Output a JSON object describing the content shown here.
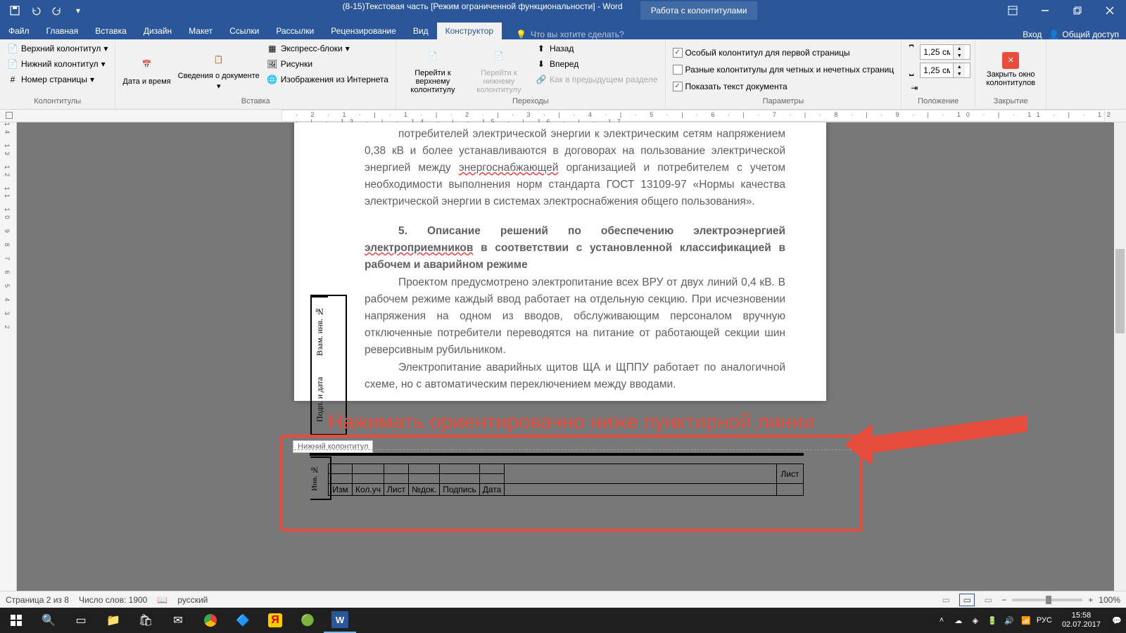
{
  "titlebar": {
    "doc_title": "(8-15)Текстовая часть [Режим ограниченной функциональности] - Word",
    "context_title": "Работа с колонтитулами"
  },
  "tabs": {
    "file": "Файл",
    "items": [
      "Главная",
      "Вставка",
      "Дизайн",
      "Макет",
      "Ссылки",
      "Рассылки",
      "Рецензирование",
      "Вид"
    ],
    "active": "Конструктор",
    "tellme": "Что вы хотите сделать?",
    "signin": "Вход",
    "share": "Общий доступ"
  },
  "ribbon": {
    "g1": {
      "top_header": "Верхний колонтитул",
      "bottom_header": "Нижний колонтитул",
      "page_num": "Номер страницы",
      "label": "Колонтитулы"
    },
    "g2": {
      "datetime": "Дата и время",
      "docinfo": "Сведения о документе",
      "quickparts": "Экспресс-блоки",
      "pictures": "Рисунки",
      "online_pics": "Изображения из Интернета",
      "label": "Вставка"
    },
    "g3": {
      "goto_header": "Перейти к верхнему колонтитулу",
      "goto_footer": "Перейти к нижнему колонтитулу",
      "prev": "Назад",
      "next": "Вперед",
      "link_prev": "Как в предыдущем разделе",
      "label": "Переходы"
    },
    "g4": {
      "diff_first": "Особый колонтитул для первой страницы",
      "diff_odd": "Разные колонтитулы для четных и нечетных страниц",
      "show_doc": "Показать текст документа",
      "label": "Параметры"
    },
    "g5": {
      "top_val": "1,25 см",
      "bottom_val": "1,25 см",
      "label": "Положение"
    },
    "g6": {
      "close": "Закрыть окно колонтитулов",
      "label": "Закрытие"
    }
  },
  "document": {
    "para1_a": "потребителей электрической энергии к электрическим сетям напряжением 0,38 кВ и более устанавливаются в договорах на пользование электрической энергией между ",
    "para1_u": "энергоснабжающей",
    "para1_b": " организацией и потребителем с учетом необходимости выполнения норм стандарта ГОСТ 13109-97 «Нормы качества электрической энергии в системах электроснабжения общего пользования».",
    "heading_a": "5. Описание решений по обеспечению электроэнергией ",
    "heading_u": "электроприемников",
    "heading_b": " в соответствии с установленной классификацией в рабочем и аварийном режиме",
    "para2": "Проектом предусмотрено электропитание всех ВРУ от двух линий 0,4 кВ. В рабочем режиме каждый ввод работает на отдельную секцию. При исчезновении напряжения на одном из вводов, обслуживающим персоналом вручную отключенные потребители переводятся на питание от работающей секции шин реверсивным рубильником.",
    "para3": "Электропитание аварийных щитов ЩА и ЩППУ работает по аналогичной схеме, но с автоматическим переключением между вводами.",
    "side1": "Взам. инв. №",
    "side2": "Подп. и дата",
    "side3": "Инв. №",
    "footer_tag": "Нижний колонтитул",
    "ft": {
      "c1": "Изм",
      "c2": "Кол.уч",
      "c3": "Лист",
      "c4": "№док.",
      "c5": "Подпись",
      "c6": "Дата",
      "sheet": "Лист"
    }
  },
  "annotation": {
    "text": "Нажимать ориентировачно ниже пунктирной линии"
  },
  "statusbar": {
    "page": "Страница 2 из 8",
    "words": "Число слов: 1900",
    "lang": "русский",
    "zoom": "100%"
  },
  "tray": {
    "lang": "РУС",
    "time": "15:58",
    "date": "02.07.2017"
  }
}
